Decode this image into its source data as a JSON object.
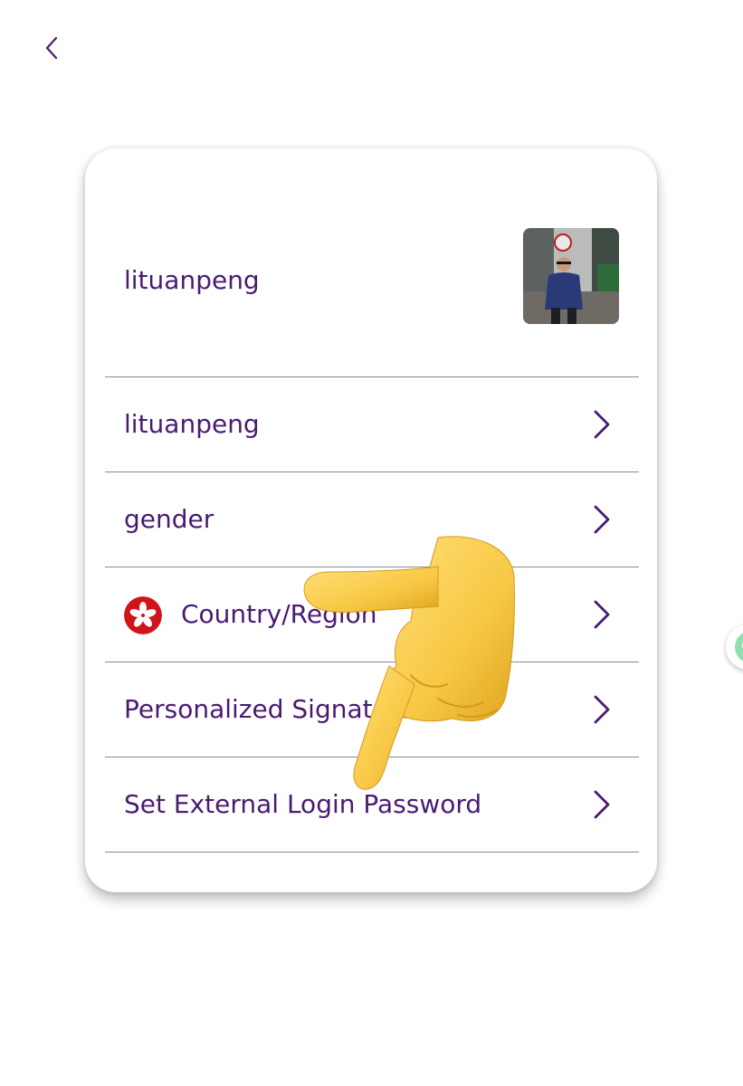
{
  "header": {
    "back_icon": "chevron-left-icon"
  },
  "profile": {
    "name": "lituanpeng",
    "avatar": "profile-photo"
  },
  "rows": [
    {
      "label": "lituanpeng",
      "icon": "chevron-right-icon"
    },
    {
      "label": "gender",
      "icon": "chevron-right-icon"
    },
    {
      "label": "Country/Region",
      "icon": "chevron-right-icon",
      "flag": "hong-kong-flag-icon"
    },
    {
      "label": "Personalized Signature",
      "icon": "chevron-right-icon"
    },
    {
      "label": "Set External Login Password",
      "icon": "chevron-right-icon"
    }
  ],
  "overlay": {
    "pointer": "pointing-hand-icon"
  },
  "colors": {
    "accent": "#4a1a72",
    "divider": "#8a8a8a",
    "flag_red": "#d0141b",
    "side_bubble": "#8fe0b0"
  }
}
